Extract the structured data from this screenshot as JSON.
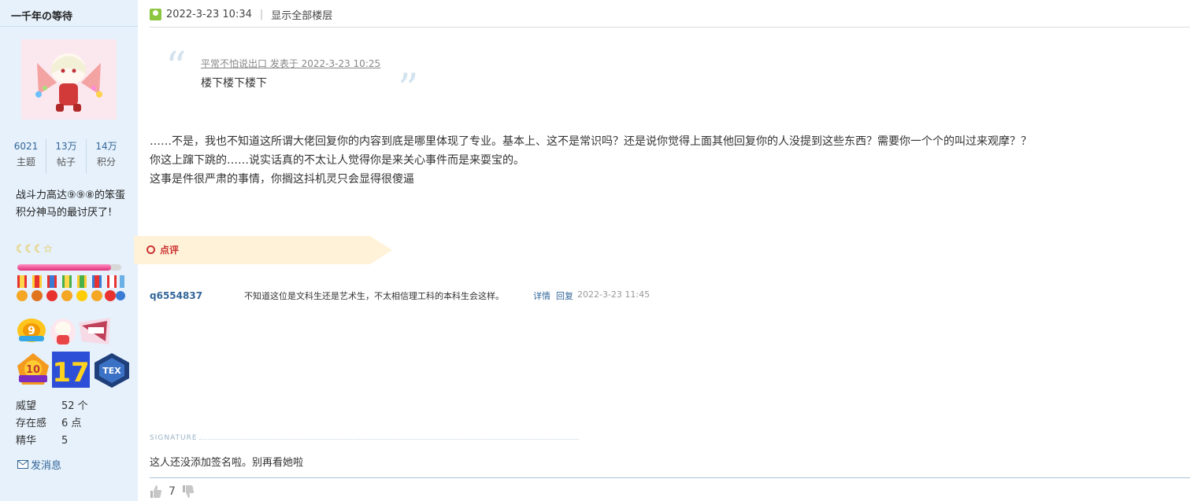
{
  "sidebar": {
    "username": "一千年の等待",
    "stats": [
      {
        "value": "6021",
        "label": "主题"
      },
      {
        "value": "13万",
        "label": "帖子"
      },
      {
        "value": "14万",
        "label": "积分"
      }
    ],
    "user_title": "战斗力高达⑨⑨⑧的笨蛋积分神马的最讨厌了!",
    "level_glyphs": "☾☾☾☆",
    "exp_fraction": 0.9,
    "info": [
      {
        "key": "威望",
        "value": "52 个"
      },
      {
        "key": "存在感",
        "value": "6 点"
      },
      {
        "key": "精华",
        "value": "5"
      }
    ],
    "pm_label": "发消息"
  },
  "post": {
    "datetime": "2022-3-23 10:34",
    "separator": "|",
    "show_all_floors": "显示全部楼层",
    "quote": {
      "meta": "平常不怕说出口 发表于 2022-3-23 10:25",
      "text": "楼下楼下楼下"
    },
    "body_lines": [
      "……不是，我也不知道这所谓大佬回复你的内容到底是哪里体现了专业。基本上、这不是常识吗？还是说你觉得上面其他回复你的人没提到这些东西？需要你一个个的叫过来观摩？？",
      "你这上蹿下跳的……说实话真的不太让人觉得你是来关心事件而是来耍宝的。",
      "这事是件很严肃的事情，你搁这抖机灵只会显得很傻逼"
    ],
    "comments_label": "点评",
    "comment": {
      "user": "q6554837",
      "text": "不知道这位是文科生还是艺术生，不太相信理工科的本科生会这样。",
      "detail": "详情",
      "reply": "回复",
      "time": "2022-3-23 11:45"
    },
    "signature_label": "SIGNATURE",
    "signature_text": "这人还没添加签名啦。别再看她啦",
    "like_count": "7"
  },
  "colors": {
    "sidebar_bg": "#e6f1fb",
    "link": "#336699",
    "accent_red": "#cc3333",
    "comment_tag_bg": "#fff2d9"
  }
}
